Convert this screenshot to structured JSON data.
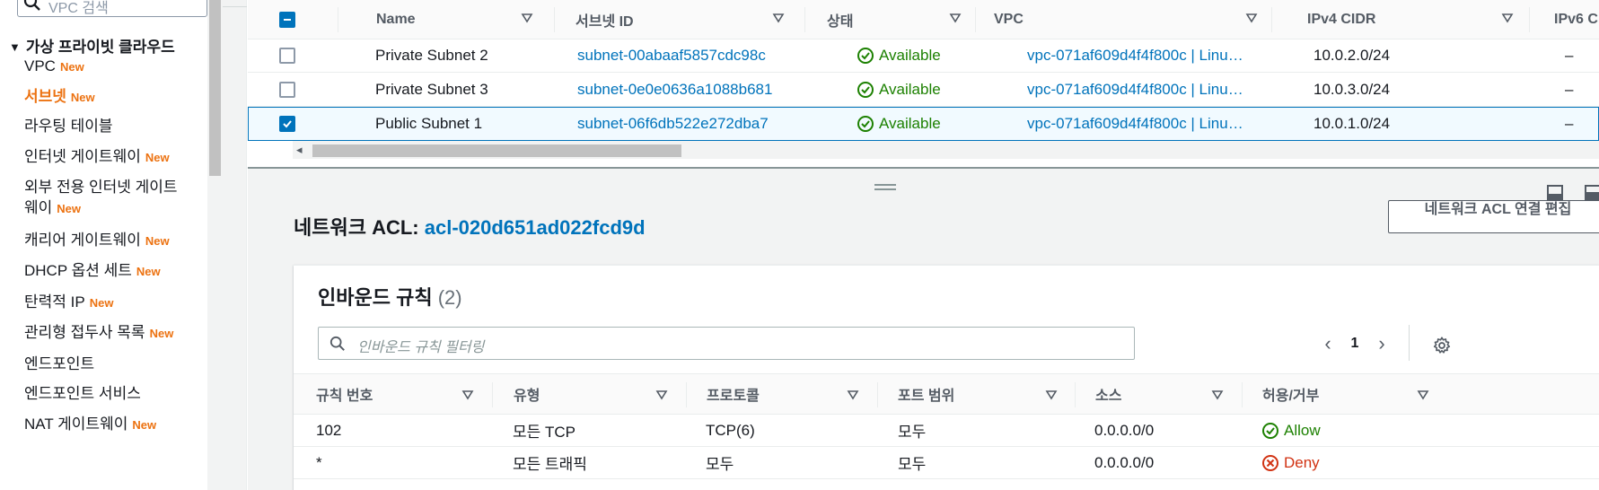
{
  "sidebar": {
    "search_placeholder": "VPC 검색",
    "section_title": "가상 프라이빗 클라우드",
    "items": [
      {
        "label": "VPC",
        "badge": "New"
      },
      {
        "label": "서브넷",
        "badge": "New"
      },
      {
        "label": "라우팅 테이블",
        "badge": ""
      },
      {
        "label": "인터넷 게이트웨이",
        "badge": "New"
      },
      {
        "label": "외부 전용 인터넷 게이트",
        "badge": ""
      },
      {
        "label": "웨이",
        "badge": "New"
      },
      {
        "label": "캐리어 게이트웨이",
        "badge": "New"
      },
      {
        "label": "DHCP 옵션 세트",
        "badge": "New"
      },
      {
        "label": "탄력적 IP",
        "badge": "New"
      },
      {
        "label": "관리형 접두사 목록",
        "badge": "New"
      },
      {
        "label": "엔드포인트",
        "badge": ""
      },
      {
        "label": "엔드포인트 서비스",
        "badge": ""
      },
      {
        "label": "NAT 게이트웨이",
        "badge": "New"
      }
    ]
  },
  "subnets": {
    "headers": [
      "Name",
      "서브넷 ID",
      "상태",
      "VPC",
      "IPv4 CIDR",
      "IPv6 C"
    ],
    "rows": [
      {
        "name": "Private Subnet 2",
        "subnet_id": "subnet-00abaaf5857cdc98c",
        "state": "Available",
        "vpc": "vpc-071af609d4f4f800c | Linu…",
        "cidr": "10.0.2.0/24",
        "ipv6": "–",
        "checked": false
      },
      {
        "name": "Private Subnet 3",
        "subnet_id": "subnet-0e0e0636a1088b681",
        "state": "Available",
        "vpc": "vpc-071af609d4f4f800c | Linu…",
        "cidr": "10.0.3.0/24",
        "ipv6": "–",
        "checked": false
      },
      {
        "name": "Public Subnet 1",
        "subnet_id": "subnet-06f6db522e272dba7",
        "state": "Available",
        "vpc": "vpc-071af609d4f4f800c | Linu…",
        "cidr": "10.0.1.0/24",
        "ipv6": "–",
        "checked": true
      }
    ]
  },
  "details": {
    "acl_label": "네트워크 ACL:",
    "acl_id": "acl-020d651ad022fcd9d",
    "edit_button": "네트워크 ACL 연결 편집"
  },
  "inbound": {
    "title": "인바운드 규칙",
    "count": "(2)",
    "filter_placeholder": "인바운드 규칙 필터링",
    "page": "1",
    "headers": [
      "규칙 번호",
      "유형",
      "프로토콜",
      "포트 범위",
      "소스",
      "허용/거부"
    ],
    "rows": [
      {
        "rule": "102",
        "type": "모든 TCP",
        "protocol": "TCP(6)",
        "ports": "모두",
        "source": "0.0.0.0/0",
        "action": "Allow"
      },
      {
        "rule": "*",
        "type": "모든 트래픽",
        "protocol": "모두",
        "ports": "모두",
        "source": "0.0.0.0/0",
        "action": "Deny"
      }
    ]
  },
  "colors": {
    "link": "#0073bb",
    "accent": "#ec7211",
    "success": "#1d8102",
    "error": "#d13212"
  }
}
